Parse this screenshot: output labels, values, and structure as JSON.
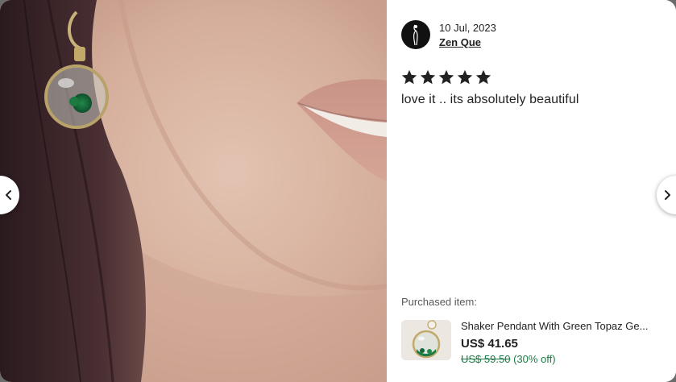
{
  "modal": {
    "photo": {
      "icon": "review-photo-image"
    },
    "reviewer": {
      "date": "10 Jul, 2023",
      "name": "Zen Que",
      "avatar_icon": "avatar-silhouette-icon"
    },
    "rating": {
      "value": 5,
      "max": 5,
      "star_icon": "star-icon",
      "star_color": "#222222"
    },
    "review_text": "love it .. its absolutely beautiful",
    "purchased": {
      "label": "Purchased item:",
      "title": "Shaker Pendant With Green Topaz Ge...",
      "price": "US$ 41.65",
      "original_price": "US$ 59.50",
      "discount": "(30% off)",
      "discount_color": "#1d7a45"
    },
    "navigation": {
      "prev_icon": "chevron-left-icon",
      "next_icon": "chevron-right-icon"
    }
  }
}
